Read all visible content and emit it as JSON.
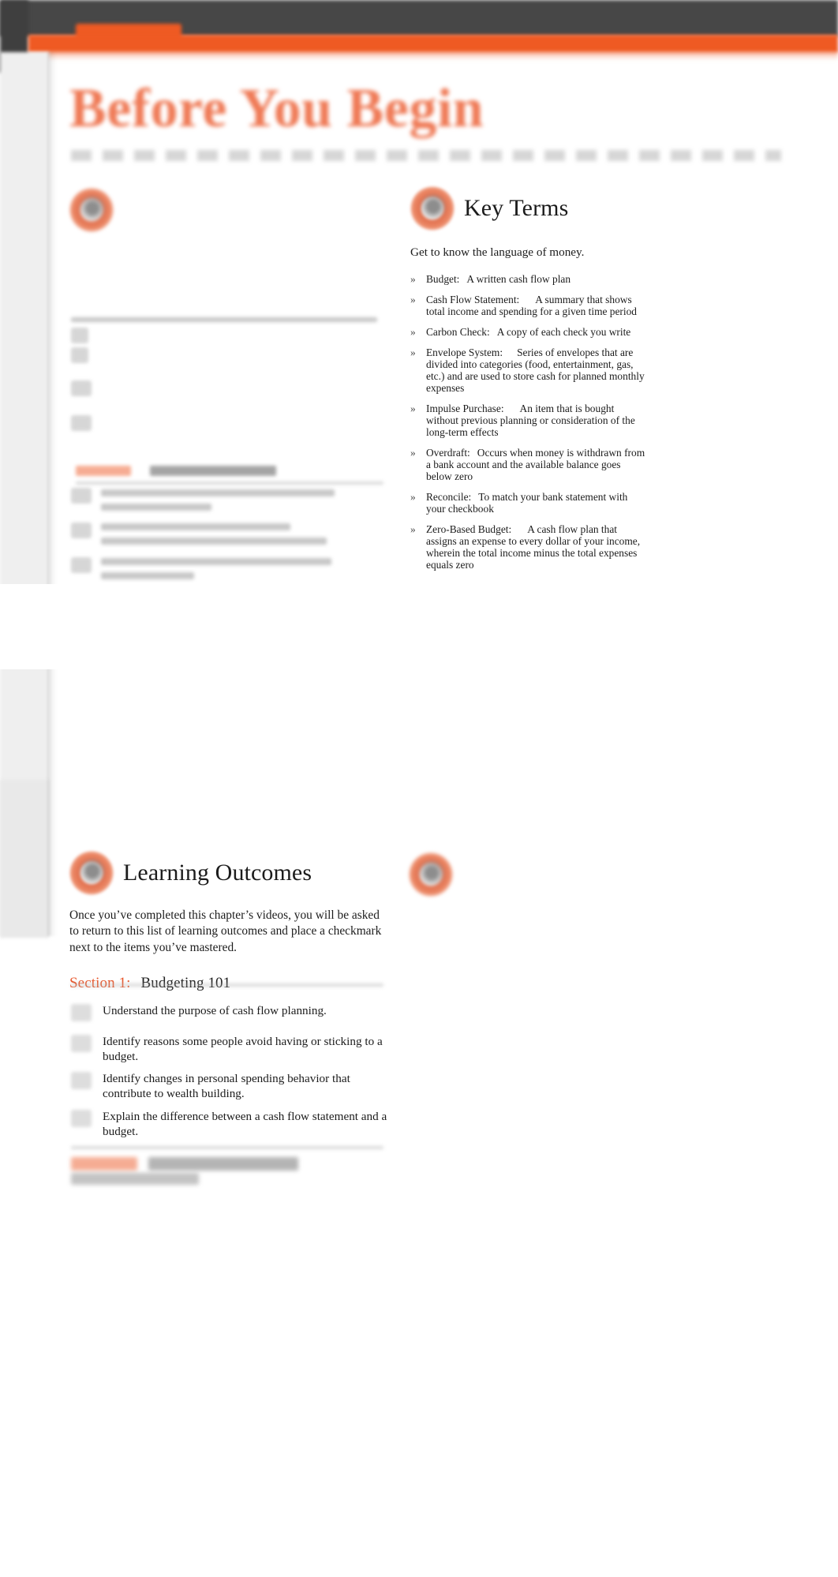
{
  "window": {
    "tab_label": "",
    "accent_color": "#ef5a23",
    "header_color": "#474747"
  },
  "hero": {
    "title": "Before You Begin"
  },
  "key_terms": {
    "icon": "target-badge-icon",
    "heading": "Key Terms",
    "subtitle": "Get to know the language of money.",
    "bullet_glyph": "»",
    "items": [
      {
        "term": "Budget:",
        "definition": "A written cash flow plan"
      },
      {
        "term": "Cash Flow Statement:",
        "definition": "A summary that shows total income and spending for a given time period"
      },
      {
        "term": "Carbon Check:",
        "definition": "A copy of each check you write"
      },
      {
        "term": "Envelope System:",
        "definition": "Series of envelopes that are divided into categories (food, entertainment, gas, etc.) and are used to store cash for planned monthly expenses"
      },
      {
        "term": "Impulse Purchase:",
        "definition": "An item that is bought without previous planning or consideration of the long-term effects"
      },
      {
        "term": "Overdraft:",
        "definition": "Occurs when money is withdrawn from a bank account and the available balance goes below zero"
      },
      {
        "term": "Reconcile:",
        "definition": "To match your bank statement with your checkbook"
      },
      {
        "term": "Zero-Based Budget:",
        "definition": "A cash flow plan that assigns an expense to every dollar of your income, wherein the total income minus the total expenses equals zero"
      }
    ]
  },
  "learning_outcomes": {
    "icon": "target-badge-icon",
    "heading": "Learning Outcomes",
    "intro": "Once you’ve completed this chapter’s videos, you will be asked to return to this list of learning outcomes and place a checkmark next to the items you’ve mastered.",
    "section": {
      "number": "Section 1:",
      "title": "Budgeting 101"
    },
    "items": [
      "Understand the purpose of cash flow planning.",
      "Identify reasons some people avoid having or sticking to a budget.",
      "Identify changes in personal spending behavior that contribute to wealth building.",
      "Explain the difference between a cash flow statement and a budget."
    ]
  }
}
